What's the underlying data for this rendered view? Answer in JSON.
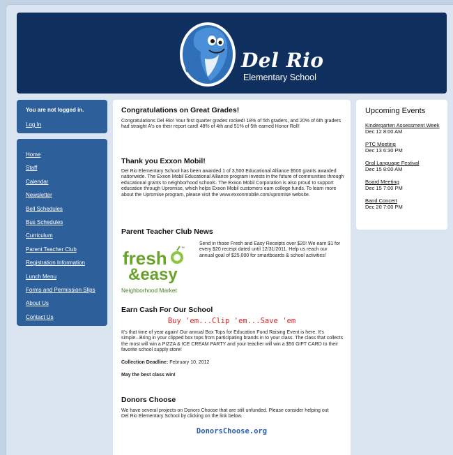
{
  "header": {
    "logo_title": "Del Rio",
    "logo_subtitle": "Elementary School"
  },
  "login": {
    "status": "You are not logged in.",
    "link": "Log In"
  },
  "nav": {
    "items": [
      "Home",
      "Staff",
      "Calendar",
      "Newsletter",
      "Bell Schedules",
      "Bus Schedules",
      "Curriculum",
      "Parent Teacher Club",
      "Registration Information",
      "Lunch Menu",
      "Forms and Permission Slips",
      "About Us",
      "Contact Us"
    ]
  },
  "main": {
    "grades": {
      "title": "Congratulations on Great Grades!",
      "body": "Congratulations Del Rio! Your first quarter grades rocked! 18% of 5th graders, and 20% of 6th graders had straight A's on their report card! 48% of 4th and 51% of 5th earned Honor Roll!"
    },
    "exxon": {
      "title": "Thank you Exxon Mobil!",
      "body": "Del Rio Elementary School has been awarded 1 of 3,500 Educational Alliance $500 grants awarded nationwide. The Exxon Mobil Educational Alliance program invests in the future of communities through educational grants to neighborhood schools. The Exxon Mobil Corporation is also proud to support education through Upromise, which helps Exxon Mobil customers earn college funds. To learn more about the Upromise program, please visit the www.exxonmobile.com/upromise website."
    },
    "ptc": {
      "title": "Parent Teacher Club News",
      "body": "Send in those Fresh and Easy Receipts over $20! We earn $1 for every $20 receipt dated until 12/31/2011. Help us reach our annual goal of $25,000 for smartboards & school activities!",
      "logo_line1": "fresh",
      "logo_line2": "&easy",
      "logo_tagline": "Neighborhood Market",
      "logo_tm": "™"
    },
    "cash": {
      "title": "Earn Cash For Our School",
      "slogan": "Buy 'em...Clip 'em...Save 'em",
      "body": "It's that time of year again! Our annual Box Tops for Education Fund Raising Event is here. It's simple...Bring in your clipped box tops from participating brands in to your class. The class that collects the most will win a PIZZA & ICE CREAM PARTY and your teacher will win a $50 GIFT CARD to their favorite school supply store!",
      "deadline_label": "Collection Deadline:",
      "deadline_value": " February 10, 2012",
      "closing": "May the best class win!"
    },
    "donors": {
      "title": "Donors Choose",
      "body": "We have several projects on Donors Choose that are still unfunded. Please consider helping out Del Rio Elementary School by clicking on the link below.",
      "link": "DonorsChoose.org"
    }
  },
  "events": {
    "title": "Upcoming Events",
    "items": [
      {
        "name": "Kindergarten Assessment Week",
        "when": "Dec 12 8:00 AM"
      },
      {
        "name": "PTC Meeting",
        "when": "Dec 13 6:30 PM"
      },
      {
        "name": "Oral Language Festival",
        "when": "Dec 15 8:00 AM"
      },
      {
        "name": "Board Meeting",
        "when": "Dec 15 7:00 PM"
      },
      {
        "name": "Band Concert",
        "when": "Dec 20 7:00 PM"
      }
    ]
  },
  "colors": {
    "banner": "#0f2f5e",
    "sidebar": "#2d5f9a",
    "page_bg": "#c3d3e6",
    "slogan_red": "#e02020",
    "link_blue": "#2c5fb0",
    "fresh_green": "#6aa22a"
  },
  "icons": {
    "logo": "dolphin-mascot-icon",
    "fresh_easy": "fresh-easy-logo"
  }
}
